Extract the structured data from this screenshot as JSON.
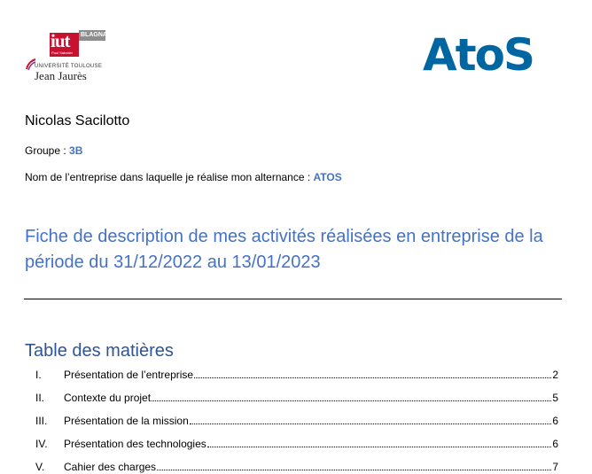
{
  "logos": {
    "iut": {
      "mark": "iut",
      "tagline": "Paul Sabatier",
      "campus": "BLAGNAC",
      "university_line1": "UNIVERSITÉ TOULOUSE",
      "university_line2": "Jean Jaurès"
    },
    "company": "AtoS"
  },
  "student": {
    "name": "Nicolas Sacilotto",
    "group_label": "Groupe : ",
    "group_value": "3B",
    "company_label": "Nom de l’entreprise dans laquelle je réalise mon alternance : ",
    "company_value": "ATOS"
  },
  "document": {
    "title": "Fiche de description de mes activités réalisées en entreprise de la période du 31/12/2022 au 13/01/2023"
  },
  "toc": {
    "heading": "Table des matières",
    "items": [
      {
        "number": "I.",
        "title": "Présentation de l’entreprise",
        "page": "2"
      },
      {
        "number": "II.",
        "title": "Contexte du projet",
        "page": "5"
      },
      {
        "number": "III.",
        "title": "Présentation de la mission",
        "page": "6"
      },
      {
        "number": "IV.",
        "title": "Présentation des technologies",
        "page": "6"
      },
      {
        "number": "V.",
        "title": "Cahier des charges",
        "page": "7"
      }
    ]
  },
  "colors": {
    "accent_blue": "#4472c4",
    "heading_blue": "#2f5496",
    "atos_blue": "#0066a1",
    "iut_red": "#c8112e"
  }
}
